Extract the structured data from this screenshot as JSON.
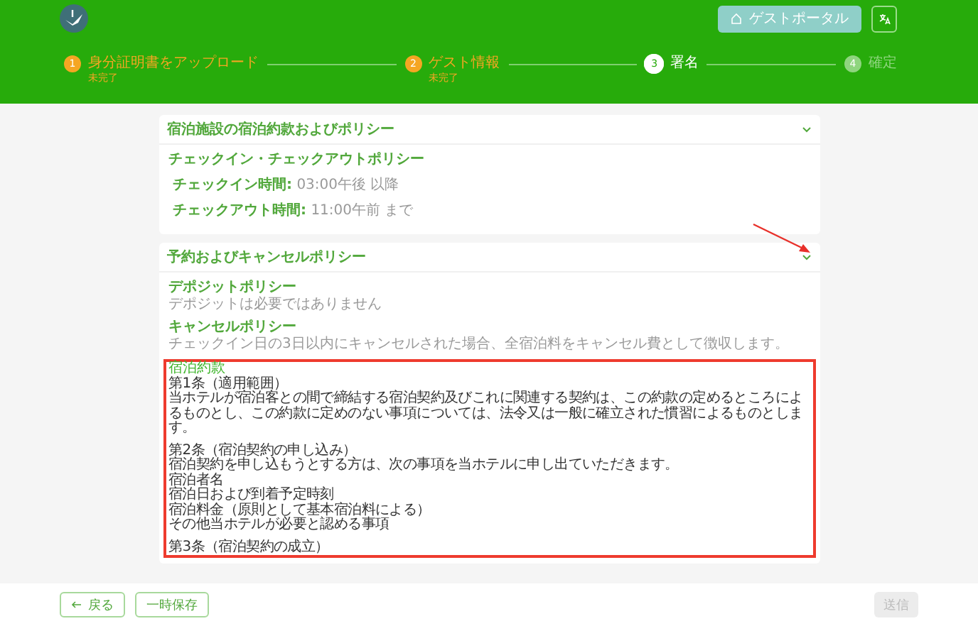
{
  "header": {
    "portal_button": "ゲストポータル"
  },
  "steps": [
    {
      "number": "1",
      "label": "身分証明書をアップロード",
      "sublabel": "未完了",
      "selected": false,
      "warning": true
    },
    {
      "number": "2",
      "label": "ゲスト情報",
      "sublabel": "未完了",
      "selected": false,
      "warning": true
    },
    {
      "number": "3",
      "label": "署名",
      "selected": true,
      "warning": false
    },
    {
      "number": "4",
      "label": "確定",
      "selected": false,
      "warning": false
    }
  ],
  "checkin_section": {
    "title": "宿泊施設の宿泊約款およびポリシー",
    "expanded": true,
    "subtitle": "チェックイン・チェックアウトポリシー",
    "rows": [
      {
        "label": "チェックイン時間:",
        "value": "03:00午後 以降"
      },
      {
        "label": "チェックアウト時間:",
        "value": "11:00午前 まで"
      }
    ]
  },
  "policy_section": {
    "title": "予約およびキャンセルポリシー",
    "expanded": true,
    "annotation_arrow": true,
    "policies": [
      {
        "title": "デポジットポリシー",
        "text": "デポジットは必要ではありません"
      },
      {
        "title": "キャンセルポリシー",
        "text": "チェックイン日の3日以内にキャンセルされた場合、全宿泊料をキャンセル費として徴収します。"
      }
    ],
    "terms": {
      "title": "宿泊約款",
      "highlighted": true,
      "paragraphs": [
        [
          "第1条（適用範囲）",
          "当ホテルが宿泊客との間で締結する宿泊契約及びこれに関連する契約は、この約款の定めるところによるものとし、この約款に定めのない事項については、法令又は一般に確立された慣習によるものとします。"
        ],
        [
          "第2条（宿泊契約の申し込み）",
          "宿泊契約を申し込もうとする方は、次の事項を当ホテルに申し出ていただきます。",
          "宿泊者名",
          "宿泊日および到着予定時刻",
          "宿泊料金（原則として基本宿泊料による）",
          "その他当ホテルが必要と認める事項"
        ],
        [
          "第3条（宿泊契約の成立）"
        ]
      ]
    }
  },
  "footer": {
    "back": "戻る",
    "save": "一時保存",
    "submit": {
      "label": "送信",
      "disabled": true
    }
  }
}
